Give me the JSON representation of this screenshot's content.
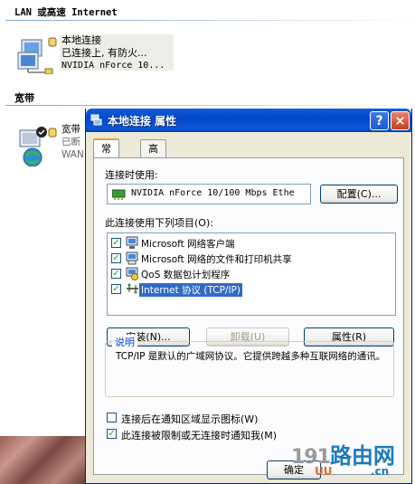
{
  "folder": {
    "sections": [
      {
        "title": "LAN 或高速 Internet"
      },
      {
        "title": "宽带"
      }
    ],
    "lan_item": {
      "name": "本地连接",
      "status": "已连接上, 有防火...",
      "device": "NVIDIA nForce 10..."
    },
    "broadband_item": {
      "name": "宽带",
      "status": "已断",
      "device": "WAN"
    }
  },
  "dialog": {
    "title": "本地连接 属性",
    "help_label": "?",
    "close_label": "×",
    "tabs": [
      {
        "label": "常规"
      },
      {
        "label": "高级"
      }
    ],
    "connect_using_label": "连接时使用:",
    "adapter_name": "NVIDIA nForce 10/100 Mbps Ethe",
    "configure_button": "配置(C)...",
    "components_label": "此连接使用下列项目(O):",
    "components": [
      {
        "label": "Microsoft 网络客户端",
        "checked": true,
        "icon": "network-client-icon"
      },
      {
        "label": "Microsoft 网络的文件和打印机共享",
        "checked": true,
        "icon": "file-share-icon"
      },
      {
        "label": "QoS 数据包计划程序",
        "checked": true,
        "icon": "qos-icon"
      },
      {
        "label": "Internet 协议 (TCP/IP)",
        "checked": true,
        "icon": "protocol-icon",
        "selected": true
      }
    ],
    "install_button": "安装(N)...",
    "uninstall_button": "卸载(U)",
    "properties_button": "属性(R)",
    "description_title": "说明",
    "description_text": "TCP/IP 是默认的广域网协议。它提供跨越多种互联网络的通讯。",
    "show_icon_label": "连接后在通知区域显示图标(W)",
    "show_icon_checked": false,
    "notify_label": "此连接被限制或无连接时通知我(M)",
    "notify_checked": true,
    "ok_button": "确定"
  },
  "watermark": {
    "number": "191",
    "name": "路由网",
    "sub": "UU",
    "domain": ".cn"
  },
  "colors": {
    "titlebar": "#0a5fdc",
    "selection": "#316ac5",
    "panel": "#fcfcfe",
    "dialog_face": "#ece9d8",
    "groupbox_title": "#0046d5"
  }
}
